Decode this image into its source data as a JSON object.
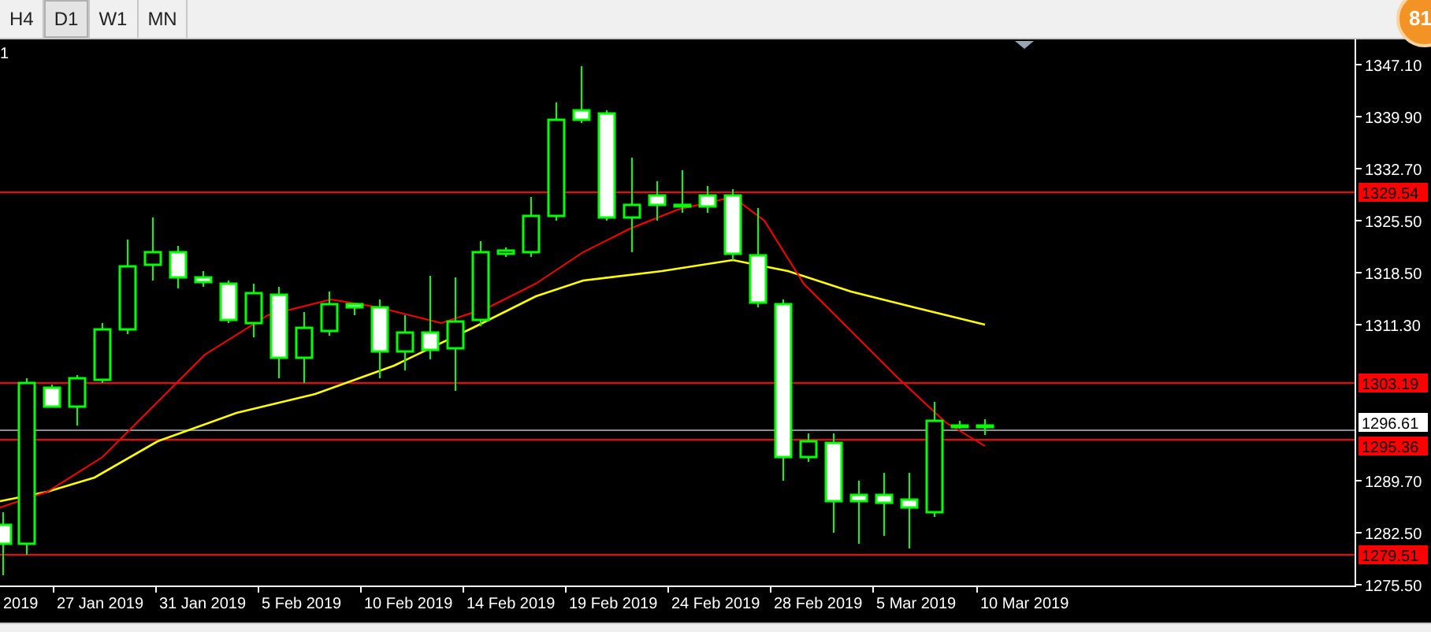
{
  "toolbar": {
    "tabs": [
      {
        "label": "H4",
        "selected": false
      },
      {
        "label": "D1",
        "selected": true
      },
      {
        "label": "W1",
        "selected": false
      },
      {
        "label": "MN",
        "selected": false
      }
    ],
    "badge": "81"
  },
  "chart": {
    "symbol_text": "1",
    "price_ticks": [
      "1347.10",
      "1339.90",
      "1332.70",
      "1325.50",
      "1318.50",
      "1311.30",
      "1289.70",
      "1282.50",
      "1275.50"
    ],
    "levels": [
      {
        "kind": "line",
        "label": "1329.54"
      },
      {
        "kind": "line",
        "label": "1303.19"
      },
      {
        "kind": "bid",
        "label": "1296.61"
      },
      {
        "kind": "line",
        "label": "1295.36"
      },
      {
        "kind": "line",
        "label": "1279.51"
      }
    ],
    "date_ticks": [
      "2019",
      "27 Jan 2019",
      "31 Jan 2019",
      "5 Feb 2019",
      "10 Feb 2019",
      "14 Feb 2019",
      "19 Feb 2019",
      "24 Feb 2019",
      "28 Feb 2019",
      "5 Mar 2019",
      "10 Mar 2019"
    ]
  }
}
